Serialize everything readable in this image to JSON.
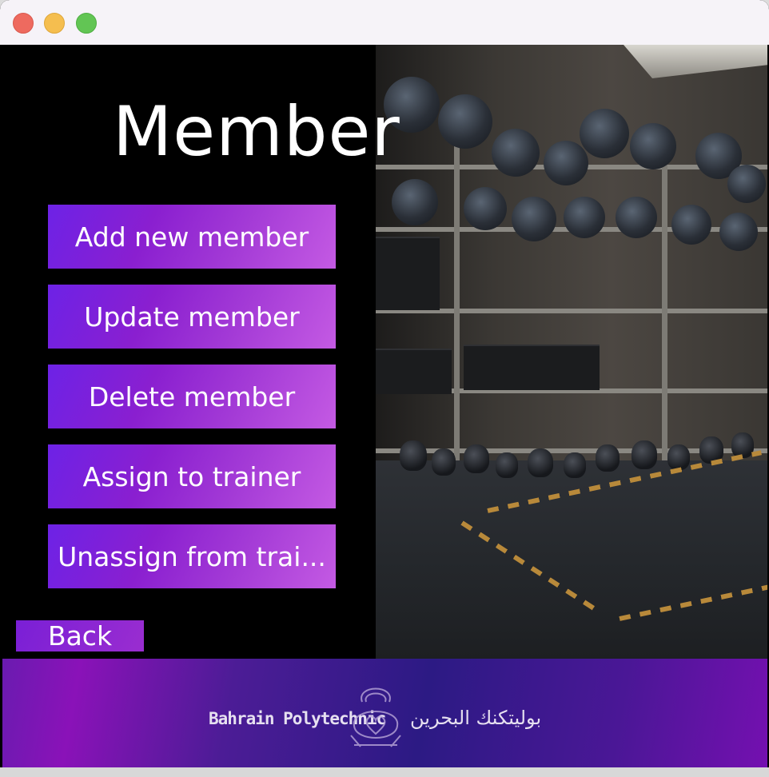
{
  "window": {
    "controls": [
      "close",
      "minimize",
      "zoom"
    ]
  },
  "header": {
    "title": "Member"
  },
  "menu": {
    "buttons": [
      {
        "label": "Add new member"
      },
      {
        "label": "Update member"
      },
      {
        "label": "Delete member"
      },
      {
        "label": "Assign to trainer"
      },
      {
        "label": "Unassign from trai..."
      }
    ]
  },
  "back_label": "Back",
  "footer": {
    "logo_en": "Bahrain Polytechnic",
    "logo_ar": "بوليتكنك البحرين",
    "logo_icon": "kettlebell-heart-logo"
  },
  "colors": {
    "button_start": "#6d22e6",
    "button_end": "#c45ae3",
    "footer_purple": "#4c1c96"
  }
}
